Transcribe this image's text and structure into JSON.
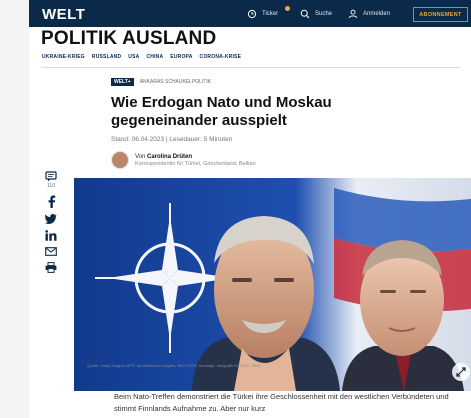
{
  "header": {
    "logo": "WELT",
    "ticker_label": "Ticker",
    "search_label": "Suche",
    "login_label": "Anmelden",
    "subscribe_label": "ABONNEMENT"
  },
  "section": {
    "title": "POLITIK AUSLAND",
    "subnav": [
      "UKRAINE-KRIEG",
      "RUSSLAND",
      "USA",
      "CHINA",
      "EUROPA",
      "CORONA-KRISE"
    ]
  },
  "article": {
    "badge": "WELT+",
    "kicker": "ANKARAS SCHAUKELPOLITIK",
    "headline": "Wie Erdogan Nato und Moskau gegeneinander ausspielt",
    "meta": "Stand: 06.04.2023 | Lesedauer: 5 Minuten",
    "author_prefix": "Von",
    "author_name": "Carolina Drüten",
    "author_role": "Korrespondentin für Türkei, Griechenland, Balkan",
    "image_caption": "Quelle: Getty Images; AFP; Sputnik/Kevin Ungaro; REUTERS; Montage: Infografik WELT/C. Stöhr",
    "body_start": "Beim Nato-Treffen demonstriert die Türkei ihre Geschlossenheit mit den westlichen Verbündeten und stimmt Finnlands Aufnahme zu. Aber nur kurz"
  },
  "share": {
    "comment_count": "110"
  },
  "colors": {
    "header_bg": "#0b2a4a",
    "accent": "#f2a23a"
  }
}
